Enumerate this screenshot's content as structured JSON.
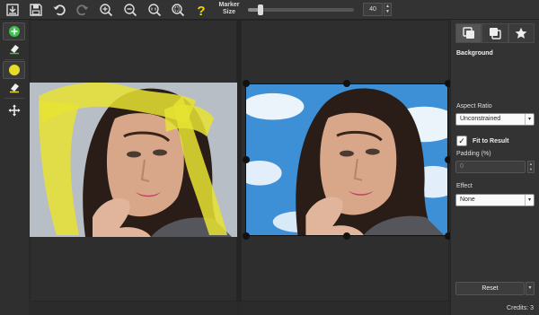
{
  "toolbar": {
    "buttons": [
      {
        "name": "open-icon"
      },
      {
        "name": "save-icon"
      },
      {
        "name": "undo-icon"
      },
      {
        "name": "redo-icon"
      },
      {
        "name": "zoom-in-icon"
      },
      {
        "name": "zoom-out-icon"
      },
      {
        "name": "zoom-actual-size-icon"
      },
      {
        "name": "zoom-fit-icon"
      },
      {
        "name": "help-icon"
      }
    ],
    "marker_label_line1": "Marker",
    "marker_label_line2": "Size",
    "marker_size_value": "40",
    "marker_size_fraction": 0.12,
    "spin_up": "▲",
    "spin_down": "▼"
  },
  "left_tools": [
    {
      "name": "add-marker-icon",
      "color": "#3dc24a"
    },
    {
      "name": "eraser-icon"
    },
    {
      "name": "highlight-marker-icon",
      "color": "#e6dd2a"
    },
    {
      "name": "eraser-icon"
    },
    {
      "name": "move-icon"
    }
  ],
  "panel": {
    "tabs": [
      {
        "name": "background-tab-icon",
        "active": true
      },
      {
        "name": "foreground-tab-icon",
        "active": false
      },
      {
        "name": "effects-star-icon",
        "active": false
      }
    ],
    "section_title": "Background",
    "aspect_ratio_label": "Aspect Ratio",
    "aspect_ratio_value": "Unconstrained",
    "fit_to_result_label": "Fit to Result",
    "fit_to_result_checked": "✓",
    "padding_label": "Padding (%)",
    "padding_value": "0",
    "effect_label": "Effect",
    "effect_value": "None",
    "reset_label": "Reset",
    "credits": "Credits: 3",
    "dropdown_arrow": "▾"
  },
  "colors": {
    "marker_yellow": "#e8e332",
    "sky_blue": "#3d8fd6",
    "add_green": "#3dc24a",
    "help_yellow": "#f5d400"
  }
}
